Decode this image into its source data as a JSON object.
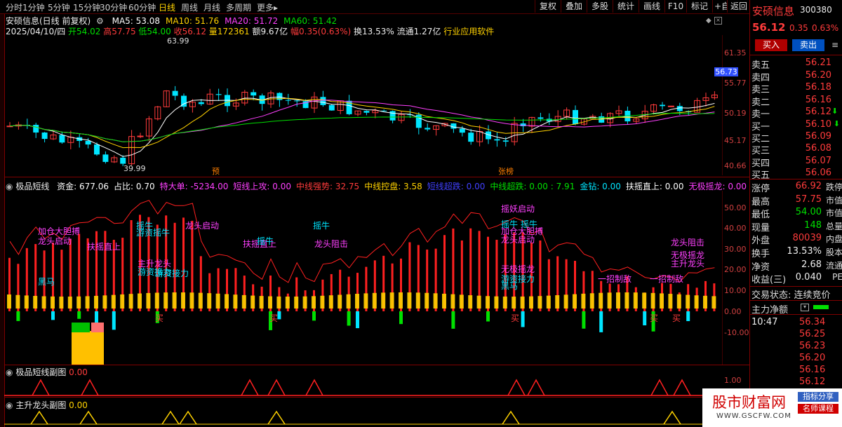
{
  "toolbar": {
    "periods": [
      "分时",
      "1分钟",
      "5分钟",
      "15分钟",
      "30分钟",
      "60分钟",
      "日线",
      "周线",
      "月线",
      "多周期",
      "更多▸"
    ],
    "active_period": "日线",
    "right_buttons": [
      "复权",
      "叠加",
      "多股",
      "统计",
      "画线",
      "F10",
      "标记",
      "+自选",
      "返回"
    ]
  },
  "main_chart": {
    "title_line": "安硕信息(日线 前复权)",
    "ma": [
      {
        "label": "MA5: 53.08",
        "color": "#ffffff"
      },
      {
        "label": "MA10: 51.76",
        "color": "#ffd200"
      },
      {
        "label": "MA20: 51.72",
        "color": "#ff40ff"
      },
      {
        "label": "MA60: 51.42",
        "color": "#00e000"
      }
    ],
    "quote_line": {
      "date": "2025/04/10/四",
      "open": "开54.02",
      "high": "高57.75",
      "low": "低54.00",
      "close": "收56.12",
      "volume": "量172361",
      "amount": "额9.67亿",
      "change": "幅0.35(0.63%)",
      "turnover": "换13.53%",
      "float": "流通1.27亿",
      "industry": "行业应用软件"
    },
    "annotations": {
      "high": "63.99",
      "low": "39.99",
      "yu": "预",
      "zhangbang": "张榜"
    },
    "axis": [
      "61.35",
      "55.77",
      "50.19",
      "45.17",
      "40.66"
    ],
    "price_tag": "56.73"
  },
  "indicator": {
    "name": "极品短线",
    "values": [
      {
        "text": "资金: 677.06",
        "color": "#ffffff"
      },
      {
        "text": "占比: 0.70",
        "color": "#ffffff"
      },
      {
        "text": "特大单: -5234.00",
        "color": "#ff40ff"
      },
      {
        "text": "短线上攻: 0.00",
        "color": "#ff40ff"
      },
      {
        "text": "中线强势: 32.75",
        "color": "#ff3b3b"
      },
      {
        "text": "中线控盘: 3.58",
        "color": "#ffd200"
      },
      {
        "text": "短线超跌: 0.00",
        "color": "#4040ff"
      },
      {
        "text": "中线超跌: 0.00 : 7.91",
        "color": "#00e000"
      },
      {
        "text": "金钻: 0.00",
        "color": "#00e5ff"
      },
      {
        "text": "扶摇直上: 0.00",
        "color": "#ffffff"
      },
      {
        "text": "无极摇龙: 0.00 : 54.00",
        "color": "#ff40ff"
      }
    ],
    "axis": [
      "50.00",
      "40.00",
      "30.00",
      "20.00",
      "10.00",
      "0.00",
      "-10.00"
    ],
    "labels": [
      {
        "text": "加仓大胆搏",
        "color": "#ff40ff"
      },
      {
        "text": "龙头启动",
        "color": "#ff40ff"
      },
      {
        "text": "扶摇直上",
        "color": "#ff40ff"
      },
      {
        "text": "黑马",
        "color": "#00e5ff"
      },
      {
        "text": "摇牛",
        "color": "#00e5ff"
      },
      {
        "text": "游资摇牛",
        "color": "#00e5ff"
      },
      {
        "text": "主升龙头",
        "color": "#ff40ff"
      },
      {
        "text": "游资接力",
        "color": "#00e5ff"
      },
      {
        "text": "游资接力",
        "color": "#00e5ff"
      },
      {
        "text": "摇牛",
        "color": "#00e5ff"
      },
      {
        "text": "龙头启动",
        "color": "#ff40ff"
      },
      {
        "text": "扶摇直上",
        "color": "#ff40ff"
      },
      {
        "text": "摇牛",
        "color": "#00e5ff"
      },
      {
        "text": "龙头阻击",
        "color": "#ff40ff"
      },
      {
        "text": "摇妖启动",
        "color": "#ff40ff"
      },
      {
        "text": "摇牛 摇牛",
        "color": "#00e5ff"
      },
      {
        "text": "加仓大胆搏",
        "color": "#ff40ff"
      },
      {
        "text": "龙头启动",
        "color": "#ff40ff"
      },
      {
        "text": "无极摇龙",
        "color": "#ff40ff"
      },
      {
        "text": "游资接力",
        "color": "#00e5ff"
      },
      {
        "text": "黑马",
        "color": "#00e5ff"
      },
      {
        "text": "一招制敌",
        "color": "#ff40ff"
      },
      {
        "text": "一招制敌",
        "color": "#ff40ff"
      },
      {
        "text": "龙头阻击",
        "color": "#ff40ff"
      },
      {
        "text": "无极摇龙",
        "color": "#ff40ff"
      },
      {
        "text": "主升龙头",
        "color": "#ff40ff"
      },
      {
        "text": "买",
        "color": "#ff3b3b"
      },
      {
        "text": "买",
        "color": "#ff3b3b"
      },
      {
        "text": "买",
        "color": "#ff3b3b"
      },
      {
        "text": "买",
        "color": "#ff3b3b"
      },
      {
        "text": "买",
        "color": "#ff3b3b"
      }
    ]
  },
  "sub1": {
    "name": "极品短线副图",
    "value": "0.00",
    "axis": "1.00"
  },
  "sub2": {
    "name": "主升龙头副图",
    "value": "0.00"
  },
  "right_panel": {
    "stock_name": "安硕信息",
    "stock_code": "300380",
    "price": "56.12",
    "change": "0.35",
    "change_pct": "0.63%",
    "buy_button": "买入",
    "sell_button": "卖出",
    "sells": [
      {
        "label": "卖五",
        "price": "56.21"
      },
      {
        "label": "卖四",
        "price": "56.20"
      },
      {
        "label": "卖三",
        "price": "56.18"
      },
      {
        "label": "卖二",
        "price": "56.16"
      },
      {
        "label": "卖一",
        "price": "56.12"
      }
    ],
    "buys": [
      {
        "label": "买一",
        "price": "56.10"
      },
      {
        "label": "买二",
        "price": "56.09"
      },
      {
        "label": "买三",
        "price": "56.08"
      },
      {
        "label": "买四",
        "price": "56.07"
      },
      {
        "label": "买五",
        "price": "56.06"
      }
    ],
    "stats": [
      {
        "label": "涨停",
        "value": "66.92",
        "color": "#ff3b3b",
        "tail": "跌停"
      },
      {
        "label": "最高",
        "value": "57.75",
        "color": "#ff3b3b",
        "tail": "市值"
      },
      {
        "label": "最低",
        "value": "54.00",
        "color": "#00e000",
        "tail": "市值"
      },
      {
        "label": "现量",
        "value": "148",
        "color": "#00e000",
        "tail": "总量"
      },
      {
        "label": "外盘",
        "value": "80039",
        "color": "#ff3b3b",
        "tail": "内盘"
      },
      {
        "label": "换手",
        "value": "13.53%",
        "color": "#eeeeee",
        "tail": "股本"
      },
      {
        "label": "净资",
        "value": "2.68",
        "color": "#eeeeee",
        "tail": "流通"
      },
      {
        "label": "收益(三)",
        "value": "0.040",
        "color": "#eeeeee",
        "tail": "PE"
      }
    ],
    "trade_status": "交易状态: 连续竞价",
    "main_net_label": "主力净额",
    "tick_time": "10:47",
    "ticks": [
      "56.34",
      "56.25",
      "56.23",
      "56.20",
      "56.16",
      "56.12"
    ]
  },
  "watermark": {
    "brand": "股市财富网",
    "tag1": "指标分享",
    "tag2": "名师课程",
    "url": "WWW.GSCFW.COM"
  }
}
